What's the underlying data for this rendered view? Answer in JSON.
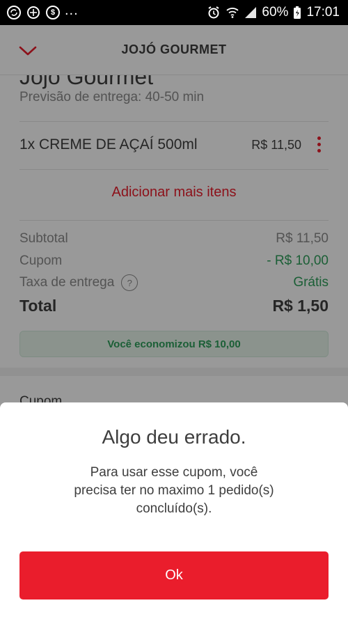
{
  "status_bar": {
    "left_icons": [
      "sync-circle-icon",
      "cloud-sync-icon",
      "dollar-circle-icon"
    ],
    "more": "...",
    "battery_percent": "60%",
    "time": "17:01"
  },
  "header": {
    "title": "JOJÓ GOURMET",
    "back_icon": "chevron-down-icon"
  },
  "store": {
    "name": "Jojó Gourmet",
    "eta": "Previsão de entrega: 40-50 min"
  },
  "cart": {
    "items": [
      {
        "qty_name": "1x  CREME DE AÇAÍ 500ml",
        "price": "R$ 11,50"
      }
    ],
    "add_more": "Adicionar mais itens"
  },
  "summary": {
    "subtotal_label": "Subtotal",
    "subtotal_value": "R$ 11,50",
    "coupon_label": "Cupom",
    "coupon_value": "- R$ 10,00",
    "delivery_label": "Taxa de entrega",
    "delivery_help": "?",
    "delivery_value": "Grátis",
    "total_label": "Total",
    "total_value": "R$ 1,50",
    "savings": "Você economizou R$ 10,00"
  },
  "coupon_section": {
    "title": "Cupom"
  },
  "dialog": {
    "title": "Algo deu errado.",
    "message": "Para usar esse cupom, você precisa ter no maximo 1 pedido(s) concluído(s).",
    "ok_label": "Ok"
  },
  "colors": {
    "brand_red": "#ea1d2c",
    "green": "#2e9e5b",
    "text": "#3e3e3e",
    "muted": "#8a8a8a"
  }
}
